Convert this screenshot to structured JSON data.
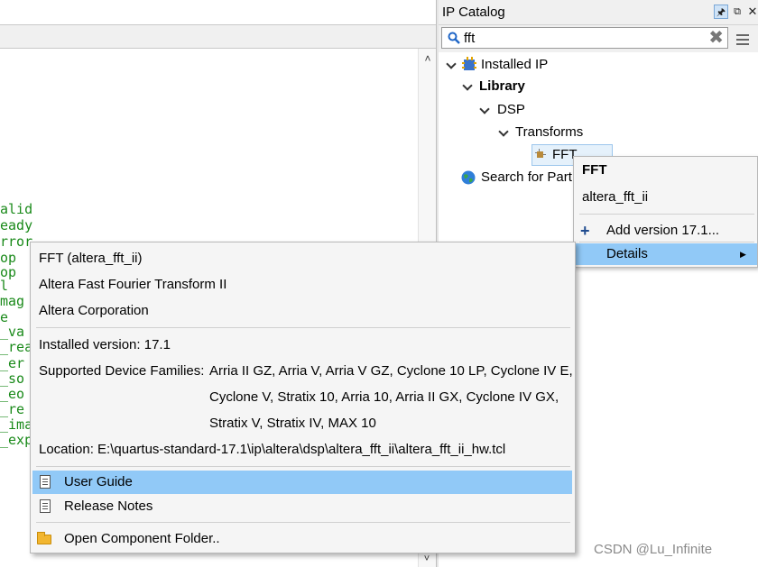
{
  "editor": {
    "code_lines": [
      "alid",
      "eady",
      "rror",
      "op",
      "op",
      "l",
      "mag",
      "e",
      "_va",
      "_rea",
      "_er",
      "_so",
      "_eo",
      "_re",
      "_ima",
      "_exp"
    ]
  },
  "ip_catalog": {
    "title": "IP Catalog",
    "search": {
      "value": "fft",
      "placeholder": ""
    },
    "tree": {
      "installed_ip": "Installed IP",
      "library": "Library",
      "dsp": "DSP",
      "transforms": "Transforms",
      "fft": "FFT",
      "search_partner": "Search for Part"
    }
  },
  "context_menu": {
    "header": "FFT",
    "subheader": "altera_fft_ii",
    "add_version": "Add version 17.1...",
    "add_symbol": "+",
    "details": "Details"
  },
  "details_popup": {
    "name": "FFT (altera_fft_ii)",
    "full_name": "Altera Fast Fourier Transform II",
    "vendor": "Altera Corporation",
    "installed_version": "Installed version: 17.1",
    "families_label": "Supported Device Families:",
    "families_line1": "Arria II GZ, Arria V, Arria V GZ, Cyclone 10 LP, Cyclone IV E,",
    "families_line2": "Cyclone V, Stratix 10, Arria 10, Arria II GX, Cyclone IV GX,",
    "families_line3": "Stratix V, Stratix IV, MAX 10",
    "location": "Location: E:\\quartus-standard-17.1\\ip\\altera\\dsp\\altera_fft_ii\\altera_fft_ii_hw.tcl",
    "actions": {
      "user_guide": "User Guide",
      "release_notes": "Release Notes",
      "open_folder": "Open Component Folder.."
    }
  },
  "watermark": "CSDN @Lu_Infinite",
  "colors": {
    "selection": "#91c9f7",
    "code_text": "#1a8a1a",
    "tree_selection": "#e5f1fb"
  }
}
